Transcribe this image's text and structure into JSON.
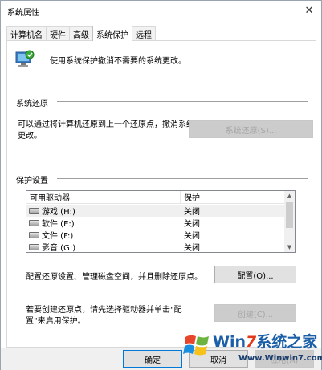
{
  "window": {
    "title": "系统属性",
    "close_glyph": "✕"
  },
  "tabs": [
    {
      "label": "计算机名",
      "active": false
    },
    {
      "label": "硬件",
      "active": false
    },
    {
      "label": "高级",
      "active": false
    },
    {
      "label": "系统保护",
      "active": true
    },
    {
      "label": "远程",
      "active": false
    }
  ],
  "header": {
    "text": "使用系统保护撤消不需要的系统更改。",
    "icon": "system-protection-icon"
  },
  "restore": {
    "group_title": "系统还原",
    "description": "可以通过将计算机还原到上一个还原点，撤消系统更改。",
    "button_label": "系统还原(S)...",
    "button_disabled": true
  },
  "protection": {
    "group_title": "保护设置",
    "columns": [
      "可用驱动器",
      "保护"
    ],
    "drives": [
      {
        "name": "游戏 (H:)",
        "status": "关闭",
        "selected": true
      },
      {
        "name": "软件 (E:)",
        "status": "关闭",
        "selected": false
      },
      {
        "name": "文件 (F:)",
        "status": "关闭",
        "selected": false
      },
      {
        "name": "影音 (G:)",
        "status": "关闭",
        "selected": false
      }
    ],
    "config_text": "配置还原设置、管理磁盘空间，并且删除还原点。",
    "config_button": "配置(O)...",
    "create_text": "若要创建还原点，请先选择驱动器并单击\"配置\"来启用保护。",
    "create_button": "创建(C)...",
    "create_disabled": true
  },
  "footer": {
    "ok_button": "确定",
    "cancel_button": "取消",
    "apply_button": "应用(A)"
  },
  "watermark": {
    "brand_prefix": "Win",
    "brand_seven": "7",
    "brand_suffix": "系统之家",
    "url": "Www.Winwin7.com"
  },
  "colors": {
    "accent": "#1b5fa8",
    "watermark_red": "#e03a1a",
    "disabled_text": "#a6a6a6",
    "button_face": "#e1e1e1"
  }
}
